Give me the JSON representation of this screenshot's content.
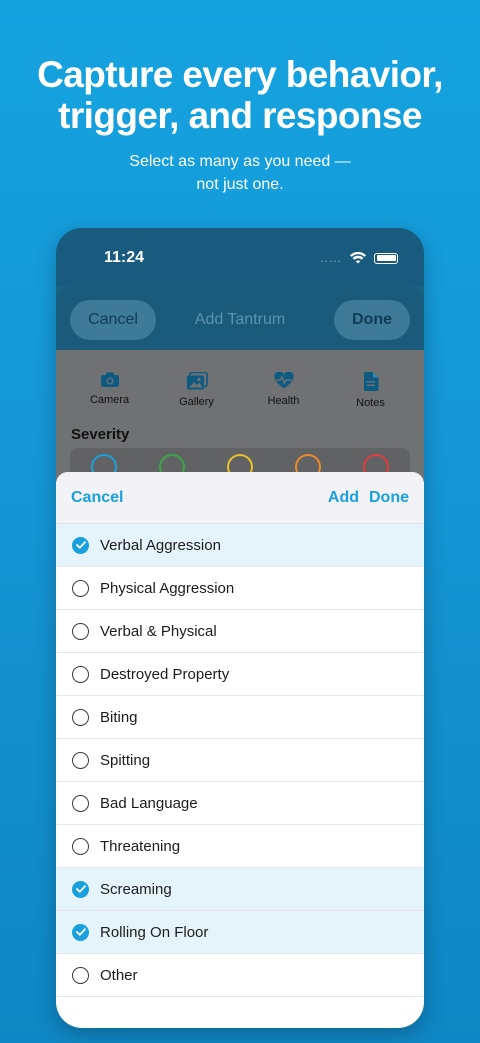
{
  "hero": {
    "title": "Capture every behavior, trigger, and response",
    "subtitle": "Select as many as you need — not just one."
  },
  "status_bar": {
    "time": "11:24",
    "dots": "....."
  },
  "add_tantrum": {
    "cancel_label": "Cancel",
    "title": "Add Tantrum",
    "done_label": "Done",
    "media": [
      {
        "label": "Camera",
        "icon": "camera-icon"
      },
      {
        "label": "Gallery",
        "icon": "gallery-icon"
      },
      {
        "label": "Health",
        "icon": "health-icon"
      },
      {
        "label": "Notes",
        "icon": "notes-icon"
      }
    ],
    "severity_label": "Severity",
    "severity_colors": [
      "#1aa0dc",
      "#3aa84a",
      "#e8c12a",
      "#f08a2a",
      "#e23b3b"
    ]
  },
  "picker": {
    "cancel_label": "Cancel",
    "add_label": "Add",
    "done_label": "Done",
    "options": [
      {
        "label": "Verbal Aggression",
        "selected": true
      },
      {
        "label": "Physical Aggression",
        "selected": false
      },
      {
        "label": "Verbal & Physical",
        "selected": false
      },
      {
        "label": "Destroyed Property",
        "selected": false
      },
      {
        "label": "Biting",
        "selected": false
      },
      {
        "label": "Spitting",
        "selected": false
      },
      {
        "label": "Bad Language",
        "selected": false
      },
      {
        "label": "Threatening",
        "selected": false
      },
      {
        "label": "Screaming",
        "selected": true
      },
      {
        "label": "Rolling On Floor",
        "selected": true
      },
      {
        "label": "Other",
        "selected": false
      }
    ]
  },
  "colors": {
    "accent": "#1aa0dc",
    "background": "#15a3e0"
  }
}
